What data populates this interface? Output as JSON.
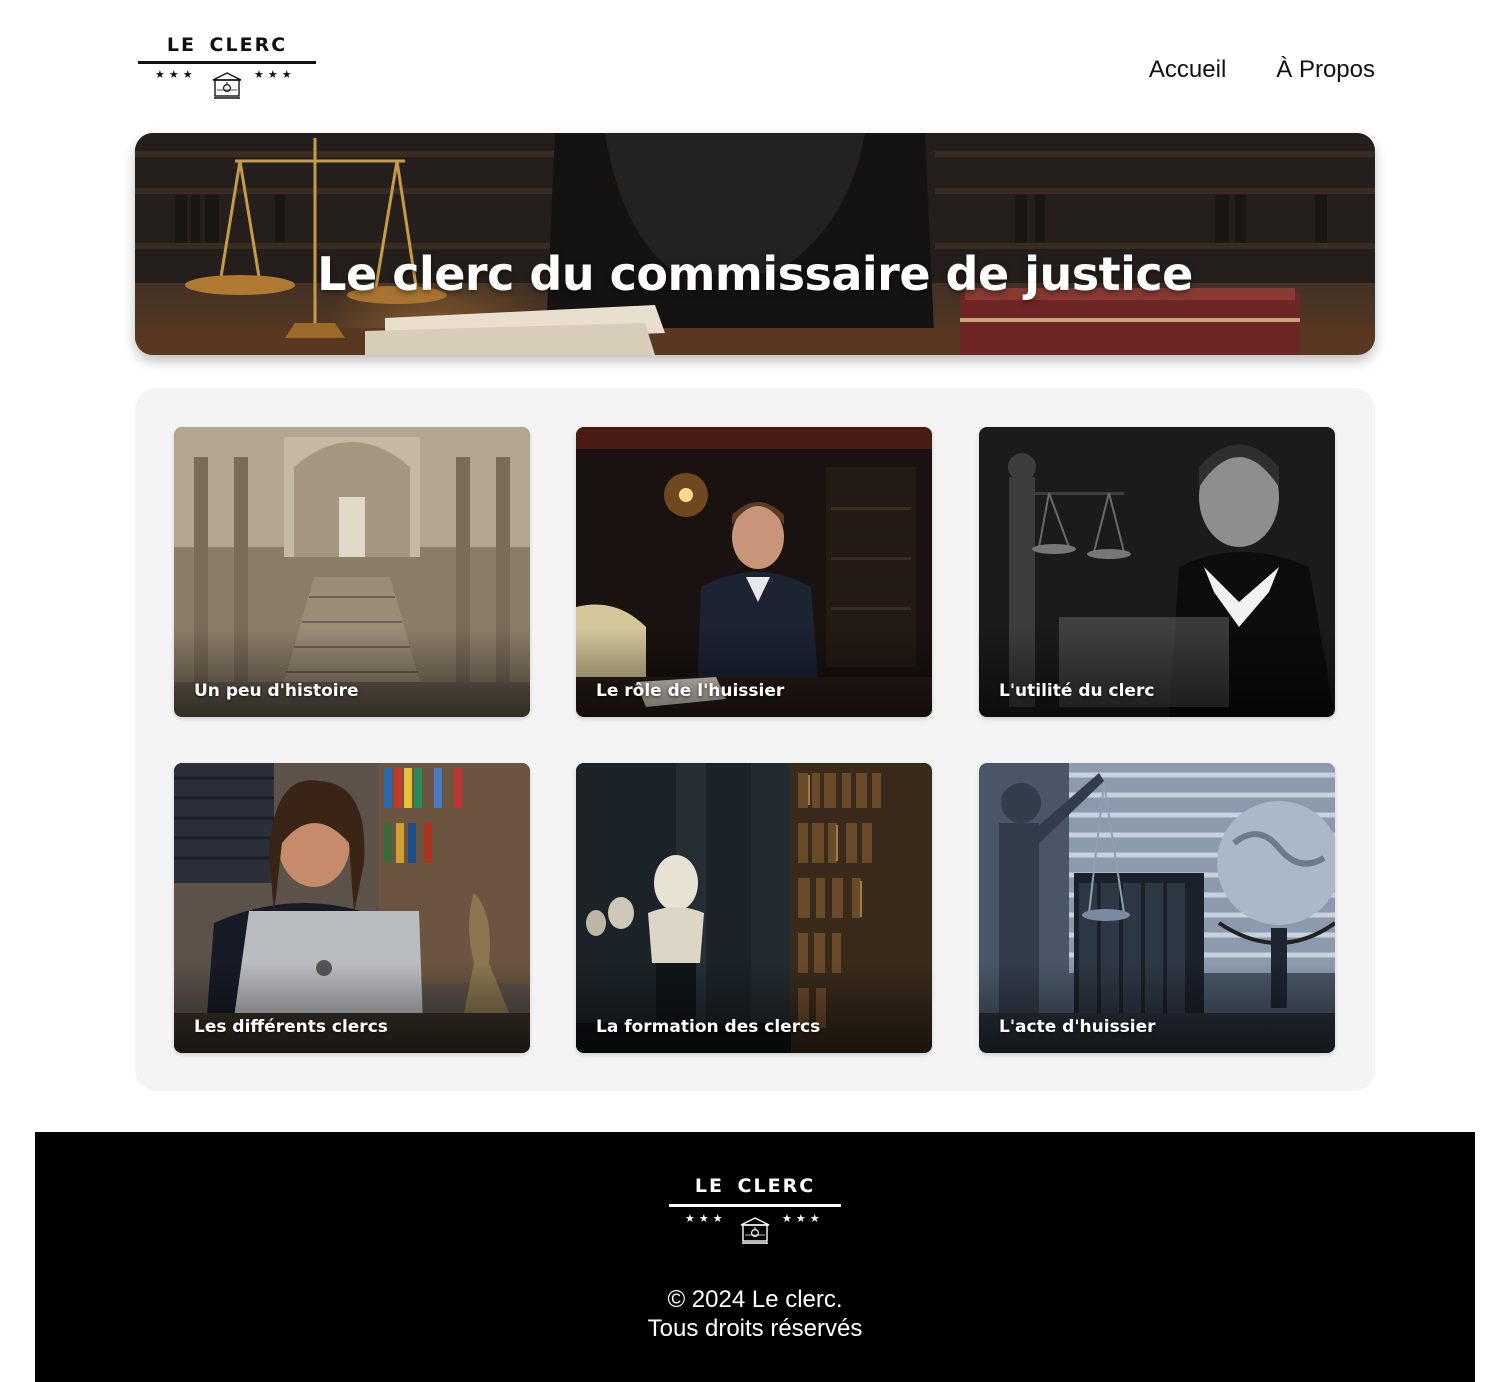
{
  "header": {
    "logo": {
      "wordmark": "LE CLERC",
      "stars_left": "★★★",
      "stars_right": "★★★",
      "emblem": "courthouse-icon"
    },
    "nav": [
      {
        "label": "Accueil"
      },
      {
        "label": "À Propos"
      }
    ]
  },
  "hero": {
    "title": "Le clerc du commissaire de justice",
    "image": "scales-of-justice-desk-photo"
  },
  "cards": [
    {
      "label": "Un peu d'histoire",
      "image": "grand-staircase-palace-photo"
    },
    {
      "label": "Le rôle de l'huissier",
      "image": "man-in-suit-library-photo"
    },
    {
      "label": "L'utilité du clerc",
      "image": "lady-justice-phone-photo"
    },
    {
      "label": "Les différents clercs",
      "image": "woman-on-phone-laptop-photo"
    },
    {
      "label": "La formation des clercs",
      "image": "library-busts-photo"
    },
    {
      "label": "L'acte d'huissier",
      "image": "lady-justice-globe-photo"
    }
  ],
  "footer": {
    "logo": {
      "wordmark": "LE CLERC",
      "stars_left": "★★★",
      "stars_right": "★★★",
      "emblem": "courthouse-icon"
    },
    "copyright_line1": "© 2024 Le clerc.",
    "copyright_line2": "Tous droits réservés"
  },
  "colors": {
    "footer_bg": "#000000",
    "panel_bg": "#f4f4f4",
    "text": "#111111",
    "inverse_text": "#ffffff"
  }
}
